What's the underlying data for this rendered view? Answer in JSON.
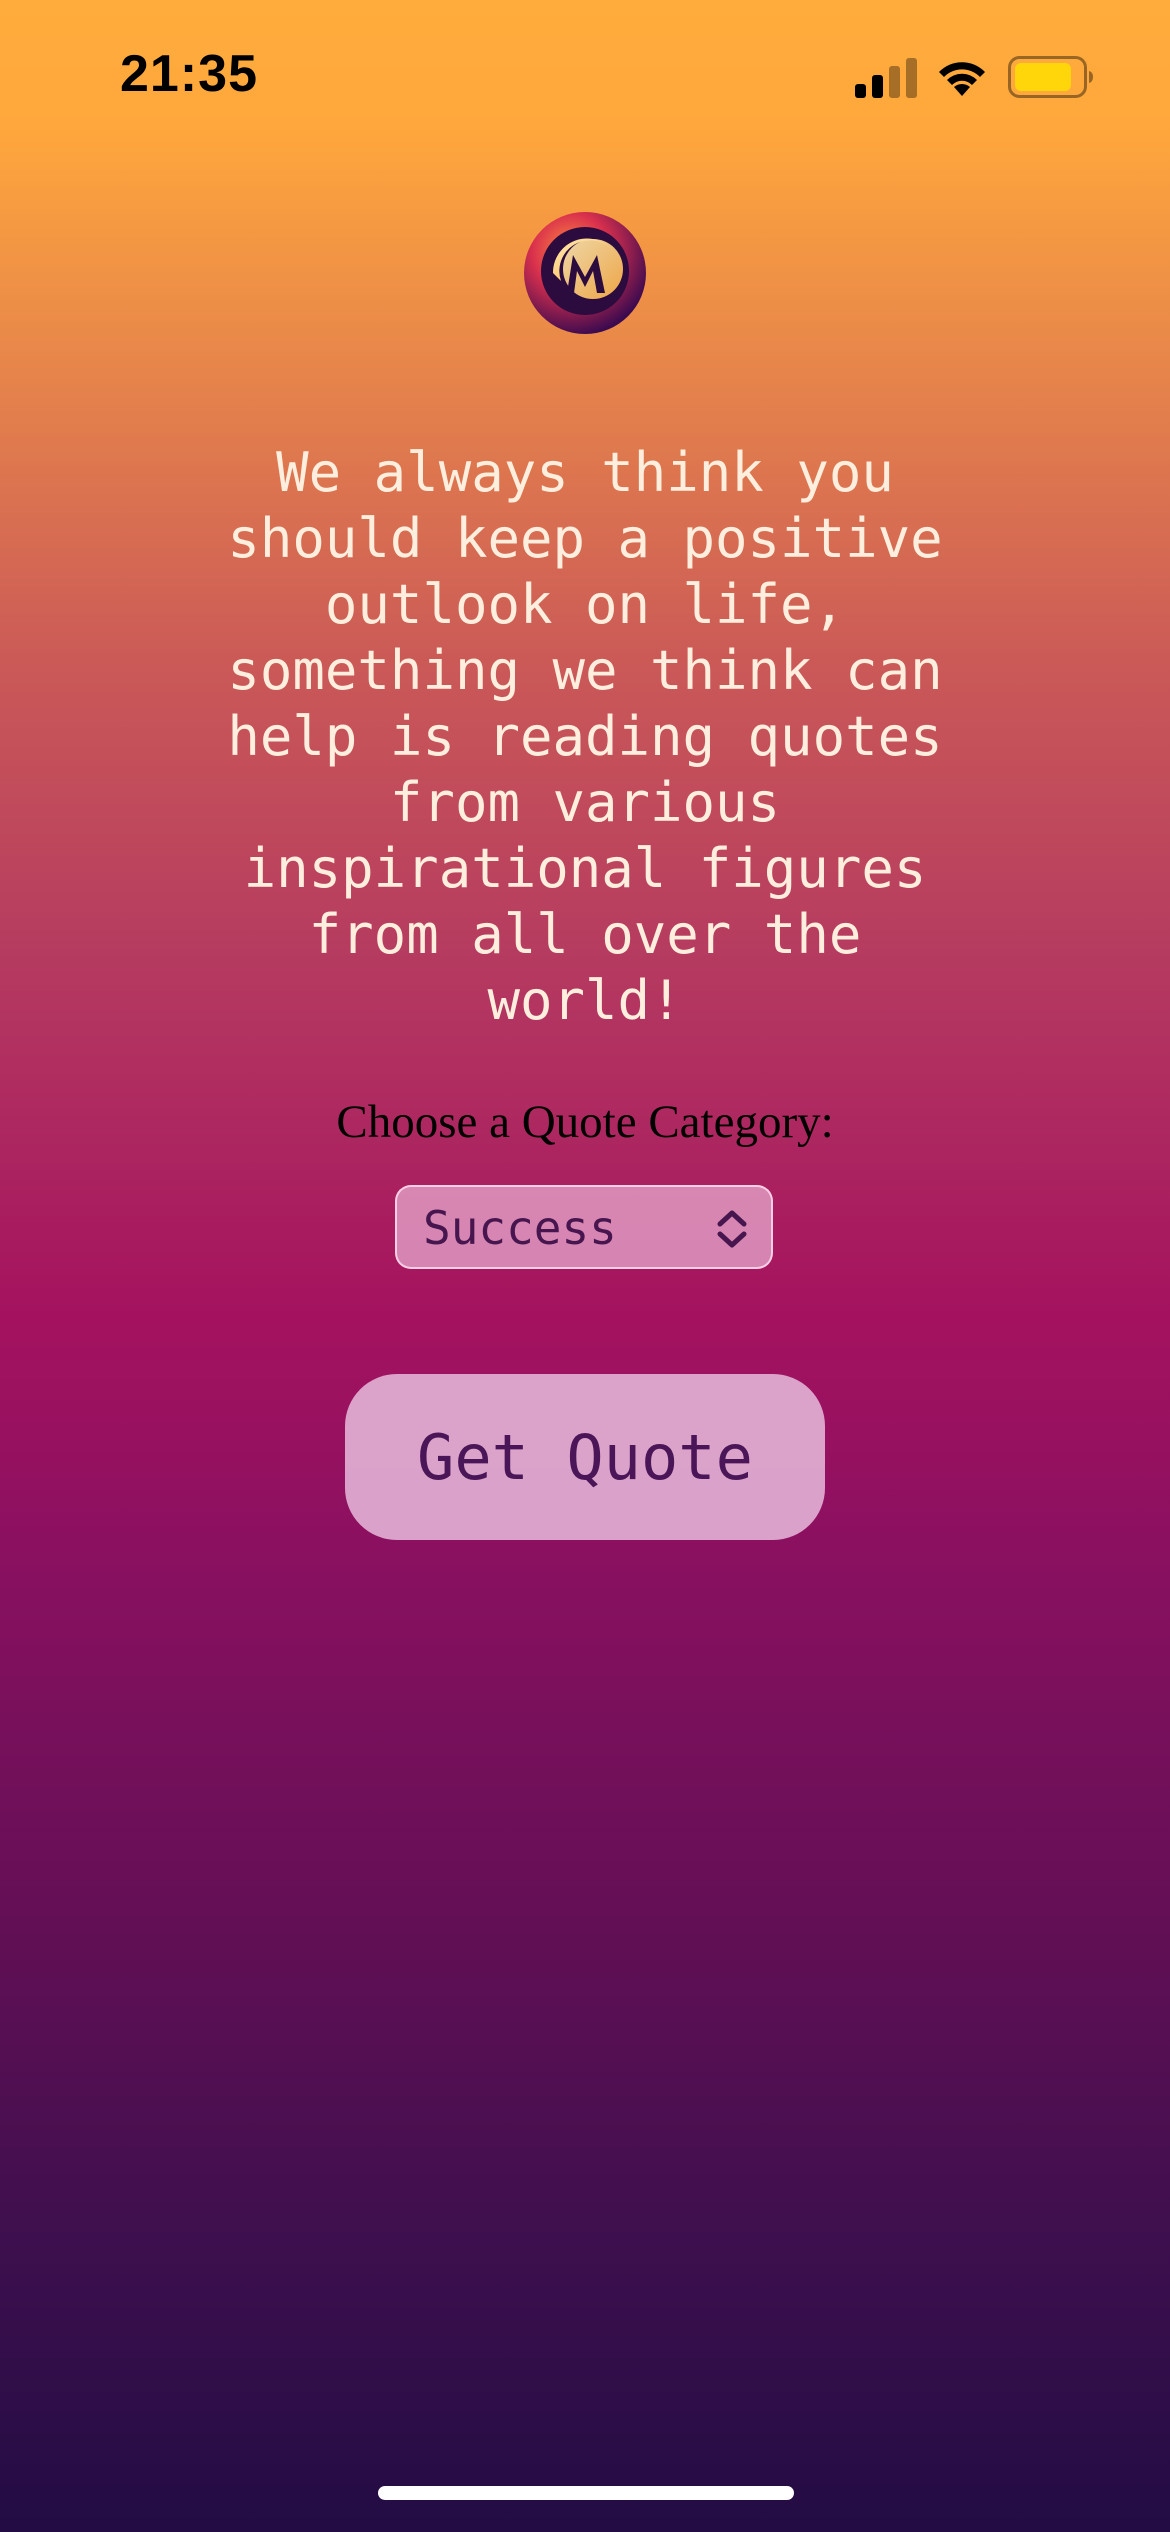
{
  "status_bar": {
    "time": "21:35",
    "signal_icon": "cellular-signal-icon",
    "wifi_icon": "wifi-icon",
    "battery_icon": "battery-icon",
    "battery_color": "#ffd60a"
  },
  "logo": {
    "icon": "m-monogram-logo",
    "letter": "M"
  },
  "intro": {
    "text": "We always think you should keep a positive outlook on life, something we think can help is reading quotes from various inspirational figures from all over the world!"
  },
  "category": {
    "label": "Choose a Quote Category:",
    "selected": "Success",
    "chevron_icon": "chevron-up-down-icon"
  },
  "actions": {
    "get_quote_label": "Get Quote"
  },
  "colors": {
    "gradient_top": "#ffac3c",
    "gradient_mid": "#a4125f",
    "gradient_bottom": "#220c43",
    "intro_text": "#fdeede",
    "button_text": "#4a1658"
  }
}
